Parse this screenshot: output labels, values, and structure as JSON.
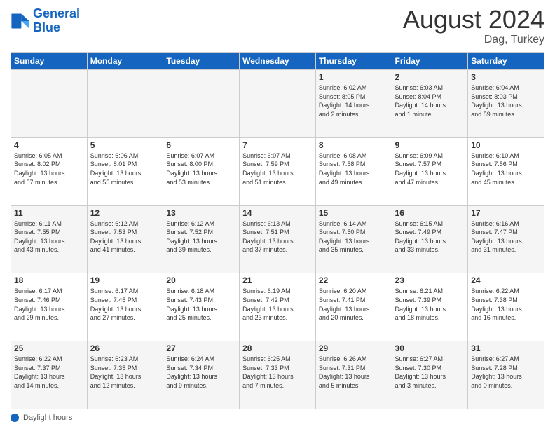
{
  "logo": {
    "line1": "General",
    "line2": "Blue"
  },
  "header": {
    "month_year": "August 2024",
    "location": "Dag, Turkey"
  },
  "days_of_week": [
    "Sunday",
    "Monday",
    "Tuesday",
    "Wednesday",
    "Thursday",
    "Friday",
    "Saturday"
  ],
  "weeks": [
    [
      {
        "day": "",
        "info": ""
      },
      {
        "day": "",
        "info": ""
      },
      {
        "day": "",
        "info": ""
      },
      {
        "day": "",
        "info": ""
      },
      {
        "day": "1",
        "info": "Sunrise: 6:02 AM\nSunset: 8:05 PM\nDaylight: 14 hours\nand 2 minutes."
      },
      {
        "day": "2",
        "info": "Sunrise: 6:03 AM\nSunset: 8:04 PM\nDaylight: 14 hours\nand 1 minute."
      },
      {
        "day": "3",
        "info": "Sunrise: 6:04 AM\nSunset: 8:03 PM\nDaylight: 13 hours\nand 59 minutes."
      }
    ],
    [
      {
        "day": "4",
        "info": "Sunrise: 6:05 AM\nSunset: 8:02 PM\nDaylight: 13 hours\nand 57 minutes."
      },
      {
        "day": "5",
        "info": "Sunrise: 6:06 AM\nSunset: 8:01 PM\nDaylight: 13 hours\nand 55 minutes."
      },
      {
        "day": "6",
        "info": "Sunrise: 6:07 AM\nSunset: 8:00 PM\nDaylight: 13 hours\nand 53 minutes."
      },
      {
        "day": "7",
        "info": "Sunrise: 6:07 AM\nSunset: 7:59 PM\nDaylight: 13 hours\nand 51 minutes."
      },
      {
        "day": "8",
        "info": "Sunrise: 6:08 AM\nSunset: 7:58 PM\nDaylight: 13 hours\nand 49 minutes."
      },
      {
        "day": "9",
        "info": "Sunrise: 6:09 AM\nSunset: 7:57 PM\nDaylight: 13 hours\nand 47 minutes."
      },
      {
        "day": "10",
        "info": "Sunrise: 6:10 AM\nSunset: 7:56 PM\nDaylight: 13 hours\nand 45 minutes."
      }
    ],
    [
      {
        "day": "11",
        "info": "Sunrise: 6:11 AM\nSunset: 7:55 PM\nDaylight: 13 hours\nand 43 minutes."
      },
      {
        "day": "12",
        "info": "Sunrise: 6:12 AM\nSunset: 7:53 PM\nDaylight: 13 hours\nand 41 minutes."
      },
      {
        "day": "13",
        "info": "Sunrise: 6:12 AM\nSunset: 7:52 PM\nDaylight: 13 hours\nand 39 minutes."
      },
      {
        "day": "14",
        "info": "Sunrise: 6:13 AM\nSunset: 7:51 PM\nDaylight: 13 hours\nand 37 minutes."
      },
      {
        "day": "15",
        "info": "Sunrise: 6:14 AM\nSunset: 7:50 PM\nDaylight: 13 hours\nand 35 minutes."
      },
      {
        "day": "16",
        "info": "Sunrise: 6:15 AM\nSunset: 7:49 PM\nDaylight: 13 hours\nand 33 minutes."
      },
      {
        "day": "17",
        "info": "Sunrise: 6:16 AM\nSunset: 7:47 PM\nDaylight: 13 hours\nand 31 minutes."
      }
    ],
    [
      {
        "day": "18",
        "info": "Sunrise: 6:17 AM\nSunset: 7:46 PM\nDaylight: 13 hours\nand 29 minutes."
      },
      {
        "day": "19",
        "info": "Sunrise: 6:17 AM\nSunset: 7:45 PM\nDaylight: 13 hours\nand 27 minutes."
      },
      {
        "day": "20",
        "info": "Sunrise: 6:18 AM\nSunset: 7:43 PM\nDaylight: 13 hours\nand 25 minutes."
      },
      {
        "day": "21",
        "info": "Sunrise: 6:19 AM\nSunset: 7:42 PM\nDaylight: 13 hours\nand 23 minutes."
      },
      {
        "day": "22",
        "info": "Sunrise: 6:20 AM\nSunset: 7:41 PM\nDaylight: 13 hours\nand 20 minutes."
      },
      {
        "day": "23",
        "info": "Sunrise: 6:21 AM\nSunset: 7:39 PM\nDaylight: 13 hours\nand 18 minutes."
      },
      {
        "day": "24",
        "info": "Sunrise: 6:22 AM\nSunset: 7:38 PM\nDaylight: 13 hours\nand 16 minutes."
      }
    ],
    [
      {
        "day": "25",
        "info": "Sunrise: 6:22 AM\nSunset: 7:37 PM\nDaylight: 13 hours\nand 14 minutes."
      },
      {
        "day": "26",
        "info": "Sunrise: 6:23 AM\nSunset: 7:35 PM\nDaylight: 13 hours\nand 12 minutes."
      },
      {
        "day": "27",
        "info": "Sunrise: 6:24 AM\nSunset: 7:34 PM\nDaylight: 13 hours\nand 9 minutes."
      },
      {
        "day": "28",
        "info": "Sunrise: 6:25 AM\nSunset: 7:33 PM\nDaylight: 13 hours\nand 7 minutes."
      },
      {
        "day": "29",
        "info": "Sunrise: 6:26 AM\nSunset: 7:31 PM\nDaylight: 13 hours\nand 5 minutes."
      },
      {
        "day": "30",
        "info": "Sunrise: 6:27 AM\nSunset: 7:30 PM\nDaylight: 13 hours\nand 3 minutes."
      },
      {
        "day": "31",
        "info": "Sunrise: 6:27 AM\nSunset: 7:28 PM\nDaylight: 13 hours\nand 0 minutes."
      }
    ]
  ],
  "footer": {
    "label": "Daylight hours"
  }
}
